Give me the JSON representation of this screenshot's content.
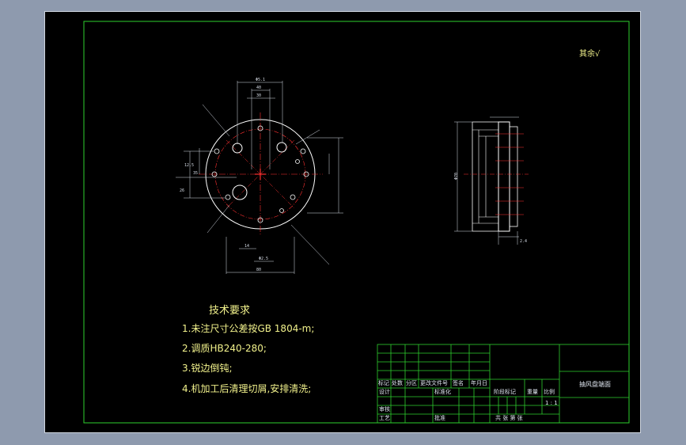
{
  "drawing": {
    "roughness_note": "其余√",
    "technical_requirements": {
      "title": "技术要求",
      "items": [
        "1.未注尺寸公差按GB 1804-m;",
        "2.调质HB240-280;",
        "3.锐边倒钝;",
        "4.机加工后清理切屑,安排清洗;"
      ]
    },
    "title_block": {
      "part_name": "抽风盘端面",
      "headers": [
        "标记",
        "处数",
        "分区",
        "更改文件号",
        "签名",
        "年月日"
      ],
      "labels": {
        "design": "设计",
        "standardize": "标准化",
        "stage_mark": "阶段标记",
        "weight": "重量",
        "scale_label": "比例",
        "review": "审核",
        "process": "工艺",
        "approve": "批准",
        "sheets": "共  张  第  张"
      },
      "scale_value": "1 : 1"
    },
    "dimensions": {
      "top_1": "Φ5.1",
      "top_2": "40",
      "top_3": "30",
      "left_1": "12.5",
      "left_2": "26",
      "left_3": "35",
      "bottom_1": "14",
      "bottom_2": "Φ2.5",
      "bottom_3": "80",
      "side_1": "Φ70",
      "side_2": "2.4"
    },
    "colors": {
      "frame": "#2ecf2e",
      "geometry": "#ffffff",
      "centerline": "#ff3030",
      "tech_text": "#f2f28c",
      "background": "#000000"
    }
  }
}
